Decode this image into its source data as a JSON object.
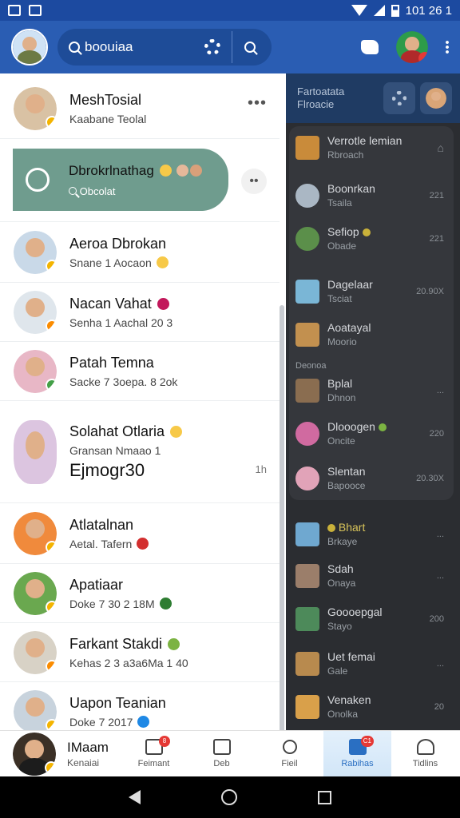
{
  "status_bar": {
    "time": "101 26 1"
  },
  "app_bar": {
    "search_text": "boouiaa"
  },
  "featured": {
    "title": "Dbrokrlnathag",
    "subtitle": "Obcolat"
  },
  "chats": [
    {
      "name": "MeshTosial",
      "sub": "Kaabane Teolal",
      "extra": "",
      "meta": ""
    },
    {
      "name": "Aeroa Dbrokan",
      "sub": "Snane 1 Aocaon",
      "extra": "",
      "meta": ""
    },
    {
      "name": "Nacan Vahat",
      "sub": "Senha 1 Aachal 20 3",
      "extra": "",
      "meta": ""
    },
    {
      "name": "Patah Temna",
      "sub": "Sacke 7 3oepa. 8 2ok",
      "extra": "",
      "meta": ""
    },
    {
      "name": "Solahat Otlaria",
      "sub": "Gransan Nmaao 1",
      "extra": "Ejmogr30",
      "meta": "1h"
    },
    {
      "name": "Atlatalnan",
      "sub": "Aetal. Tafern",
      "extra": "",
      "meta": ""
    },
    {
      "name": "Apatiaar",
      "sub": "Doke 7 30 2 18M",
      "extra": "",
      "meta": ""
    },
    {
      "name": "Farkant Stakdi",
      "sub": "Kehas 2 3 a3a6Ma 1 40",
      "extra": "",
      "meta": ""
    },
    {
      "name": "Uapon Teanian",
      "sub": "Doke 7 2017",
      "extra": "",
      "meta": ""
    }
  ],
  "right_panel": {
    "header_line1": "Fartoatata",
    "header_line2": "Flroacie",
    "section_label": "Deonoa",
    "items": [
      {
        "name": "Verrotle lemian",
        "sub": "Rbroach",
        "meta": ""
      },
      {
        "name": "Boonrkan",
        "sub": "Tsaila",
        "meta": "221"
      },
      {
        "name": "Sefiop",
        "sub": "Obade",
        "meta": "221"
      },
      {
        "name": "Dagelaar",
        "sub": "Tsciat",
        "meta": "20.90X"
      },
      {
        "name": "Aoatayal",
        "sub": "Moorio",
        "meta": ""
      },
      {
        "name": "Bplal",
        "sub": "Dhnon",
        "meta": "..."
      },
      {
        "name": "Dlooogen",
        "sub": "Oncite",
        "meta": "220"
      },
      {
        "name": "Slentan",
        "sub": "Bapooce",
        "meta": "20.30X"
      },
      {
        "name": "Bhart",
        "sub": "Brkaye",
        "meta": "..."
      },
      {
        "name": "Sdah",
        "sub": "Onaya",
        "meta": "..."
      },
      {
        "name": "Goooepgal",
        "sub": "Stayo",
        "meta": "200"
      },
      {
        "name": "Uet femai",
        "sub": "Gale",
        "meta": "..."
      },
      {
        "name": "Venaken",
        "sub": "Onolka",
        "meta": "20"
      }
    ]
  },
  "bottom_nav": {
    "profile_name": "IMaam",
    "profile_sub": "Kenaiai",
    "tabs": [
      {
        "label": "Feimant",
        "badge": "8"
      },
      {
        "label": "Deb",
        "badge": ""
      },
      {
        "label": "Fieil",
        "badge": ""
      },
      {
        "label": "Rabihas",
        "badge": "C1"
      },
      {
        "label": "Tidlins",
        "badge": ""
      }
    ]
  }
}
